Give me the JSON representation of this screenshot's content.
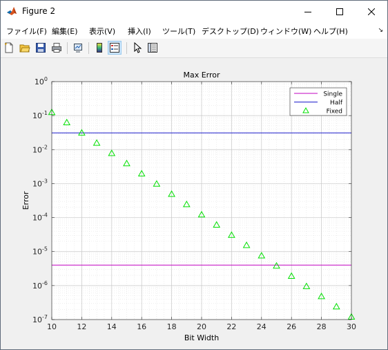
{
  "window": {
    "title": "Figure 2",
    "controls": [
      "minimize",
      "maximize",
      "close"
    ]
  },
  "menu": {
    "items": [
      "ファイル(F)",
      "編集(E)",
      "表示(V)",
      "挿入(I)",
      "ツール(T)",
      "デスクトップ(D)",
      "ウィンドウ(W)",
      "ヘルプ(H)"
    ]
  },
  "toolbar": {
    "icons": [
      "new-figure-icon",
      "open-file-icon",
      "save-icon",
      "print-icon",
      "link-plot-icon",
      "insert-colorbar-icon",
      "insert-legend-icon",
      "edit-plot-icon",
      "property-inspector-icon"
    ]
  },
  "chart_data": {
    "type": "line",
    "title": "Max Error",
    "xlabel": "Bit Width",
    "ylabel": "Error",
    "xlim": [
      10,
      30
    ],
    "ylim": [
      1e-07,
      1
    ],
    "yscale": "log",
    "grid": true,
    "minor_grid": true,
    "legend_location": "top-right",
    "xticks": [
      "10",
      "12",
      "14",
      "16",
      "18",
      "20",
      "22",
      "24",
      "26",
      "28",
      "30"
    ],
    "yticks": [
      {
        "base": "10",
        "exp": "-7"
      },
      {
        "base": "10",
        "exp": "-6"
      },
      {
        "base": "10",
        "exp": "-5"
      },
      {
        "base": "10",
        "exp": "-4"
      },
      {
        "base": "10",
        "exp": "-3"
      },
      {
        "base": "10",
        "exp": "-2"
      },
      {
        "base": "10",
        "exp": "-1"
      },
      {
        "base": "10",
        "exp": "0"
      }
    ],
    "series": [
      {
        "name": "Single",
        "kind": "line",
        "color": "#c000c0",
        "x": [
          10,
          30
        ],
        "y": [
          4e-06,
          4e-06
        ]
      },
      {
        "name": "Half",
        "kind": "line",
        "color": "#1a1acc",
        "x": [
          10,
          30
        ],
        "y": [
          0.031,
          0.031
        ]
      },
      {
        "name": "Fixed",
        "kind": "marker",
        "marker": "triangle",
        "color": "#00e000",
        "x": [
          10,
          11,
          12,
          13,
          14,
          15,
          16,
          17,
          18,
          19,
          20,
          21,
          22,
          23,
          24,
          25,
          26,
          27,
          28,
          29,
          30
        ],
        "y": [
          0.125,
          0.0625,
          0.03125,
          0.0156,
          0.0078,
          0.0039,
          0.00195,
          0.00098,
          0.00049,
          0.000244,
          0.000122,
          6.1e-05,
          3.05e-05,
          1.53e-05,
          7.6e-06,
          3.8e-06,
          1.9e-06,
          9.5e-07,
          4.8e-07,
          2.4e-07,
          1.2e-07
        ]
      }
    ]
  },
  "colors": {
    "accent": "#0078d7",
    "figure_bg": "#f0f0f0",
    "axes_bg": "#ffffff"
  }
}
